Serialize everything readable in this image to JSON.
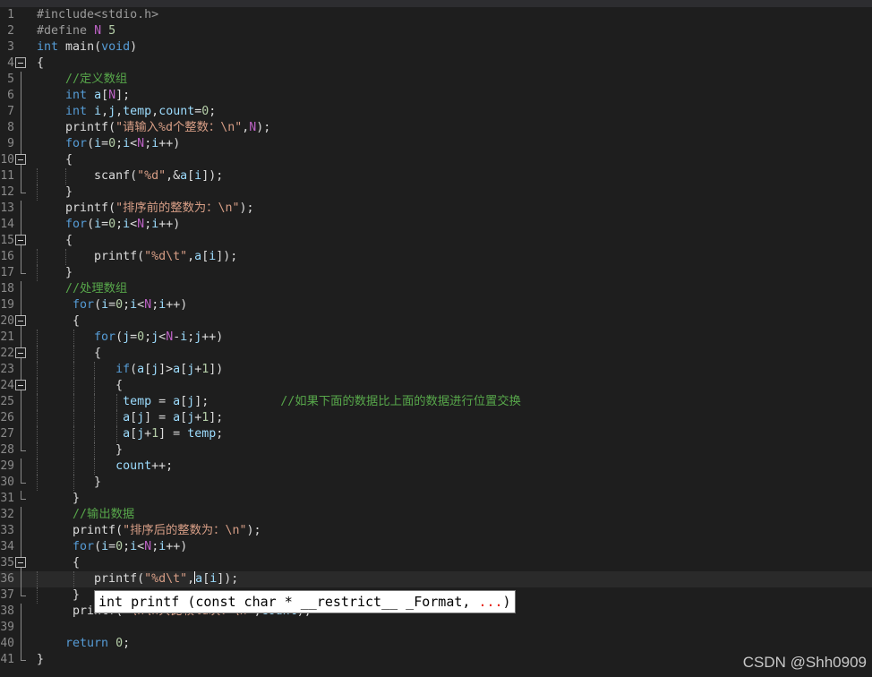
{
  "editor": {
    "current_line": 36,
    "lines": [
      {
        "n": "1",
        "fold": "none",
        "html": "<span style=\"color:#9b9b9b\">#include&lt;stdio.h&gt;</span>"
      },
      {
        "n": "2",
        "fold": "none",
        "html": "<span style=\"color:#9b9b9b\">#define</span> <span style=\"color:#bd63c5\">N</span> <span style=\"color:#b5cea8\">5</span>"
      },
      {
        "n": "3",
        "fold": "none",
        "html": "<span style=\"color:#569cd6\">int</span> <span style=\"color:#dcdcdc\">main</span>(<span style=\"color:#569cd6\">void</span>)"
      },
      {
        "n": "4",
        "fold": "start",
        "html": "{"
      },
      {
        "n": "5",
        "fold": "line",
        "html": "    <span style=\"color:#57a64a\">//定义数组</span>"
      },
      {
        "n": "6",
        "fold": "line",
        "html": "    <span style=\"color:#569cd6\">int</span> <span style=\"color:#9cdcfe\">a</span>[<span style=\"color:#bd63c5\">N</span>];"
      },
      {
        "n": "7",
        "fold": "line",
        "html": "    <span style=\"color:#569cd6\">int</span> <span style=\"color:#9cdcfe\">i</span>,<span style=\"color:#9cdcfe\">j</span>,<span style=\"color:#9cdcfe\">temp</span>,<span style=\"color:#9cdcfe\">count</span>=<span style=\"color:#b5cea8\">0</span>;"
      },
      {
        "n": "8",
        "fold": "line",
        "html": "    <span style=\"color:#dcdcdc\">printf</span>(<span style=\"color:#d69d85\">\"请输入%d个整数：\\n\"</span>,<span style=\"color:#bd63c5\">N</span>);"
      },
      {
        "n": "9",
        "fold": "line",
        "html": "    <span style=\"color:#569cd6\">for</span>(<span style=\"color:#9cdcfe\">i</span>=<span style=\"color:#b5cea8\">0</span>;<span style=\"color:#9cdcfe\">i</span>&lt;<span style=\"color:#bd63c5\">N</span>;<span style=\"color:#9cdcfe\">i</span>++)"
      },
      {
        "n": "10",
        "fold": "start",
        "html": "    {"
      },
      {
        "n": "11",
        "fold": "line",
        "html": "        <span style=\"color:#dcdcdc\">scanf</span>(<span style=\"color:#d69d85\">\"%d\"</span>,&amp;<span style=\"color:#9cdcfe\">a</span>[<span style=\"color:#9cdcfe\">i</span>]);"
      },
      {
        "n": "12",
        "fold": "end",
        "html": "    }"
      },
      {
        "n": "13",
        "fold": "line",
        "html": "    <span style=\"color:#dcdcdc\">printf</span>(<span style=\"color:#d69d85\">\"排序前的整数为：\\n\"</span>);"
      },
      {
        "n": "14",
        "fold": "line",
        "html": "    <span style=\"color:#569cd6\">for</span>(<span style=\"color:#9cdcfe\">i</span>=<span style=\"color:#b5cea8\">0</span>;<span style=\"color:#9cdcfe\">i</span>&lt;<span style=\"color:#bd63c5\">N</span>;<span style=\"color:#9cdcfe\">i</span>++)"
      },
      {
        "n": "15",
        "fold": "start",
        "html": "    {"
      },
      {
        "n": "16",
        "fold": "line",
        "html": "        <span style=\"color:#dcdcdc\">printf</span>(<span style=\"color:#d69d85\">\"%d\\t\"</span>,<span style=\"color:#9cdcfe\">a</span>[<span style=\"color:#9cdcfe\">i</span>]);"
      },
      {
        "n": "17",
        "fold": "end",
        "html": "    }"
      },
      {
        "n": "18",
        "fold": "line",
        "html": "    <span style=\"color:#57a64a\">//处理数组</span>"
      },
      {
        "n": "19",
        "fold": "line",
        "html": "     <span style=\"color:#569cd6\">for</span>(<span style=\"color:#9cdcfe\">i</span>=<span style=\"color:#b5cea8\">0</span>;<span style=\"color:#9cdcfe\">i</span>&lt;<span style=\"color:#bd63c5\">N</span>;<span style=\"color:#9cdcfe\">i</span>++)"
      },
      {
        "n": "20",
        "fold": "start",
        "html": "     {"
      },
      {
        "n": "21",
        "fold": "line",
        "html": "        <span style=\"color:#569cd6\">for</span>(<span style=\"color:#9cdcfe\">j</span>=<span style=\"color:#b5cea8\">0</span>;<span style=\"color:#9cdcfe\">j</span>&lt;<span style=\"color:#bd63c5\">N</span>-<span style=\"color:#9cdcfe\">i</span>;<span style=\"color:#9cdcfe\">j</span>++)"
      },
      {
        "n": "22",
        "fold": "start",
        "html": "        {"
      },
      {
        "n": "23",
        "fold": "line",
        "html": "           <span style=\"color:#569cd6\">if</span>(<span style=\"color:#9cdcfe\">a</span>[<span style=\"color:#9cdcfe\">j</span>]&gt;<span style=\"color:#9cdcfe\">a</span>[<span style=\"color:#9cdcfe\">j</span>+<span style=\"color:#b5cea8\">1</span>])"
      },
      {
        "n": "24",
        "fold": "start",
        "html": "           {"
      },
      {
        "n": "25",
        "fold": "line",
        "html": "            <span style=\"color:#9cdcfe\">temp</span> = <span style=\"color:#9cdcfe\">a</span>[<span style=\"color:#9cdcfe\">j</span>];          <span style=\"color:#57a64a\">//如果下面的数据比上面的数据进行位置交换</span>"
      },
      {
        "n": "26",
        "fold": "line",
        "html": "            <span style=\"color:#9cdcfe\">a</span>[<span style=\"color:#9cdcfe\">j</span>] = <span style=\"color:#9cdcfe\">a</span>[<span style=\"color:#9cdcfe\">j</span>+<span style=\"color:#b5cea8\">1</span>];"
      },
      {
        "n": "27",
        "fold": "line",
        "html": "            <span style=\"color:#9cdcfe\">a</span>[<span style=\"color:#9cdcfe\">j</span>+<span style=\"color:#b5cea8\">1</span>] = <span style=\"color:#9cdcfe\">temp</span>;"
      },
      {
        "n": "28",
        "fold": "end",
        "html": "           }"
      },
      {
        "n": "29",
        "fold": "line",
        "html": "           <span style=\"color:#9cdcfe\">count</span>++;"
      },
      {
        "n": "30",
        "fold": "end",
        "html": "        }"
      },
      {
        "n": "31",
        "fold": "end",
        "html": "     }"
      },
      {
        "n": "32",
        "fold": "line",
        "html": "     <span style=\"color:#57a64a\">//输出数据</span>"
      },
      {
        "n": "33",
        "fold": "line",
        "html": "     <span style=\"color:#dcdcdc\">printf</span>(<span style=\"color:#d69d85\">\"排序后的整数为：\\n\"</span>);"
      },
      {
        "n": "34",
        "fold": "line",
        "html": "     <span style=\"color:#569cd6\">for</span>(<span style=\"color:#9cdcfe\">i</span>=<span style=\"color:#b5cea8\">0</span>;<span style=\"color:#9cdcfe\">i</span>&lt;<span style=\"color:#bd63c5\">N</span>;<span style=\"color:#9cdcfe\">i</span>++)"
      },
      {
        "n": "35",
        "fold": "start",
        "html": "     {"
      },
      {
        "n": "36",
        "fold": "line",
        "html": "        <span style=\"color:#dcdcdc\">printf</span>(<span style=\"color:#d69d85\">\"%d\\t\"</span>,<span class=\"caret\"></span><span style=\"color:#9cdcfe\">a</span>[<span style=\"color:#9cdcfe\">i</span>]);"
      },
      {
        "n": "37",
        "fold": "end",
        "html": "     }"
      },
      {
        "n": "38",
        "fold": "line",
        "html": "     <span style=\"color:#dcdcdc\">printf</span>(<span style=\"color:#d69d85\">\"\\n\\n共比较%d次：\\n\"</span>,<span style=\"color:#9cdcfe\">count</span>);"
      },
      {
        "n": "39",
        "fold": "line",
        "html": ""
      },
      {
        "n": "40",
        "fold": "line",
        "html": "    <span style=\"color:#569cd6\">return</span> <span style=\"color:#b5cea8\">0</span>;"
      },
      {
        "n": "41",
        "fold": "end",
        "html": "}"
      }
    ]
  },
  "tooltip": {
    "signature": "int printf (const char * __restrict__ _Format, ",
    "dots": "...",
    "close": ")"
  },
  "watermark": "CSDN @Shh0909"
}
